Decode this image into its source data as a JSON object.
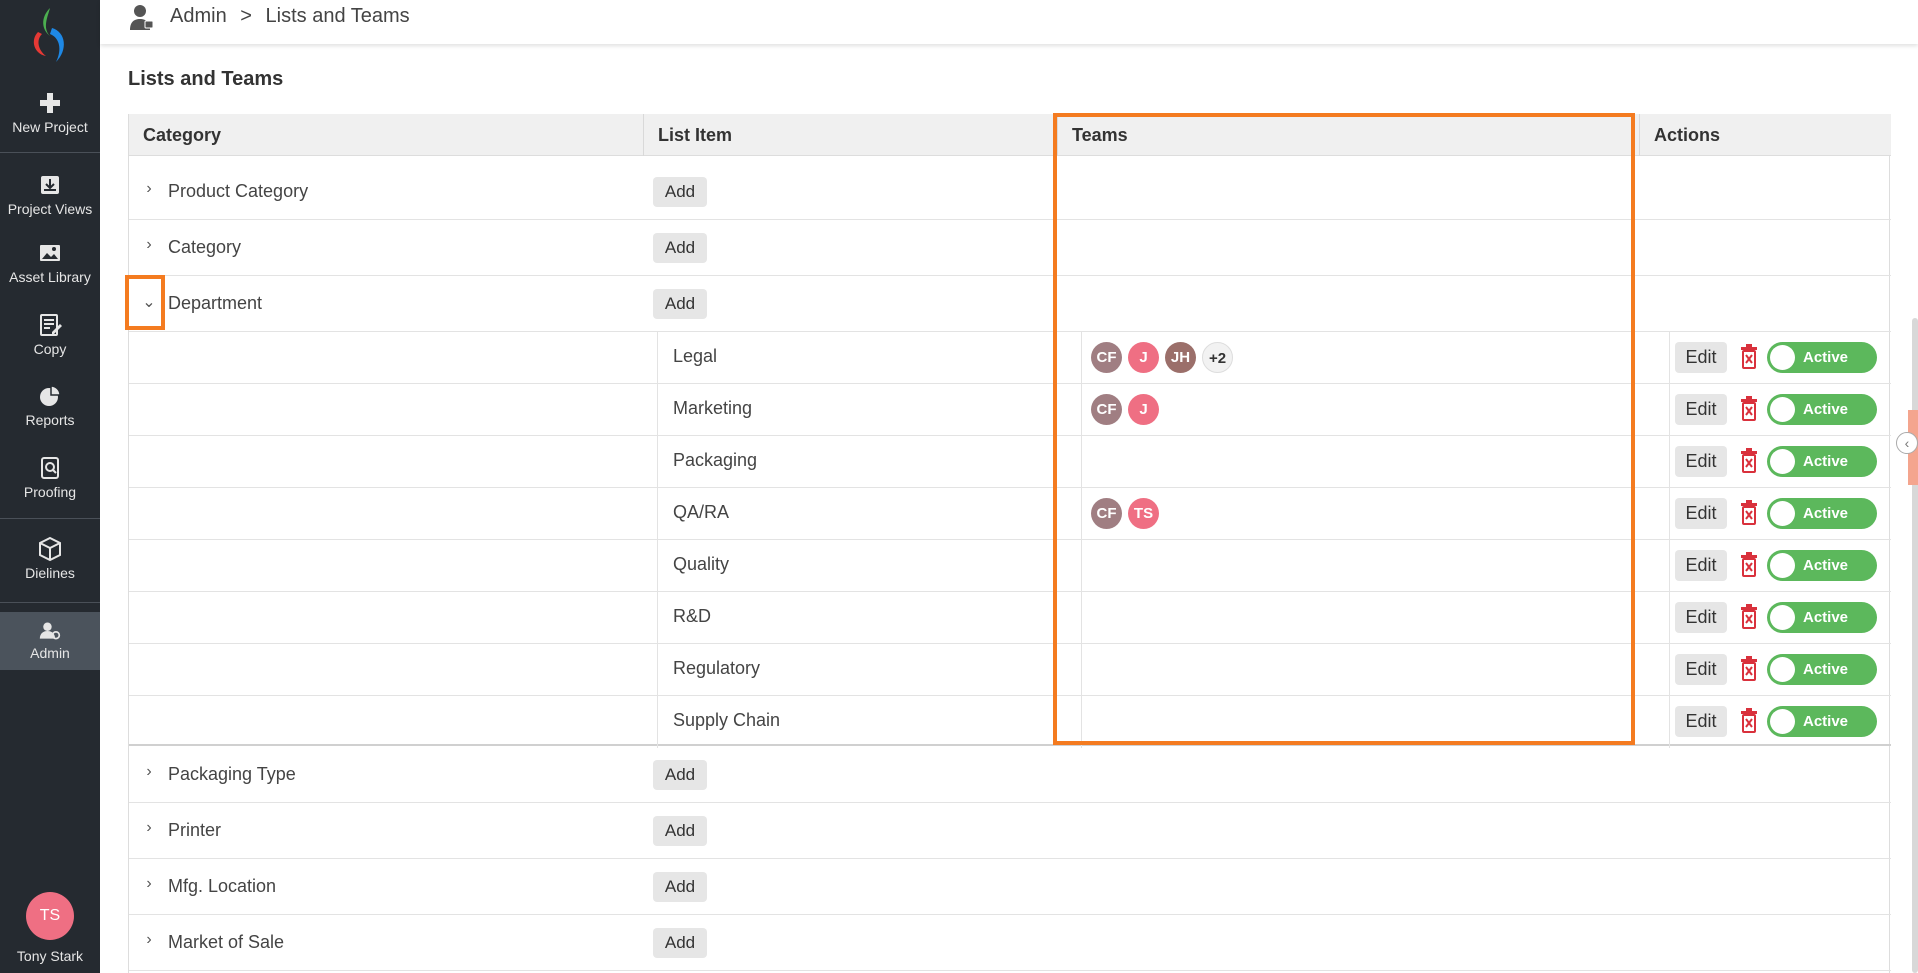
{
  "sidebar": {
    "items": [
      {
        "label": "New Project",
        "icon": "plus-icon"
      },
      {
        "label": "Project Views",
        "icon": "inbox-download-icon"
      },
      {
        "label": "Asset Library",
        "icon": "image-icon"
      },
      {
        "label": "Copy",
        "icon": "edit-document-icon"
      },
      {
        "label": "Reports",
        "icon": "pie-chart-icon"
      },
      {
        "label": "Proofing",
        "icon": "document-search-icon"
      },
      {
        "label": "Dielines",
        "icon": "cube-icon"
      },
      {
        "label": "Admin",
        "icon": "admin-user-icon"
      }
    ],
    "user": {
      "initials": "TS",
      "name": "Tony Stark"
    }
  },
  "header": {
    "breadcrumb": [
      "Admin",
      ">",
      "Lists and Teams"
    ]
  },
  "page": {
    "title": "Lists and Teams"
  },
  "table": {
    "headers": [
      "Category",
      "List Item",
      "Teams",
      "Actions"
    ],
    "add_label": "Add",
    "edit_label": "Edit",
    "status_label": "Active",
    "categories_before": [
      {
        "label": "Product Category",
        "expanded": false
      },
      {
        "label": "Category",
        "expanded": false
      },
      {
        "label": "Department",
        "expanded": true
      }
    ],
    "department_items": [
      {
        "label": "Legal",
        "teams": [
          "CF",
          "J",
          "JH"
        ],
        "more": "+2"
      },
      {
        "label": "Marketing",
        "teams": [
          "CF",
          "J"
        ],
        "more": ""
      },
      {
        "label": "Packaging",
        "teams": [],
        "more": ""
      },
      {
        "label": "QA/RA",
        "teams": [
          "CF",
          "TS"
        ],
        "more": ""
      },
      {
        "label": "Quality",
        "teams": [],
        "more": ""
      },
      {
        "label": "R&D",
        "teams": [],
        "more": ""
      },
      {
        "label": "Regulatory",
        "teams": [],
        "more": ""
      },
      {
        "label": "Supply Chain",
        "teams": [],
        "more": ""
      }
    ],
    "categories_after": [
      {
        "label": "Packaging Type"
      },
      {
        "label": "Printer"
      },
      {
        "label": "Mfg. Location"
      },
      {
        "label": "Market of Sale"
      }
    ]
  },
  "colors": {
    "sidebar_bg": "#252a30",
    "highlight": "#f47b20",
    "active_toggle": "#5cb85c",
    "avatar_CF": "#a07e82",
    "avatar_J": "#ef6f83",
    "avatar_JH": "#9b6f6a",
    "avatar_TS": "#ef6f83",
    "trash_red": "#d9313c"
  }
}
